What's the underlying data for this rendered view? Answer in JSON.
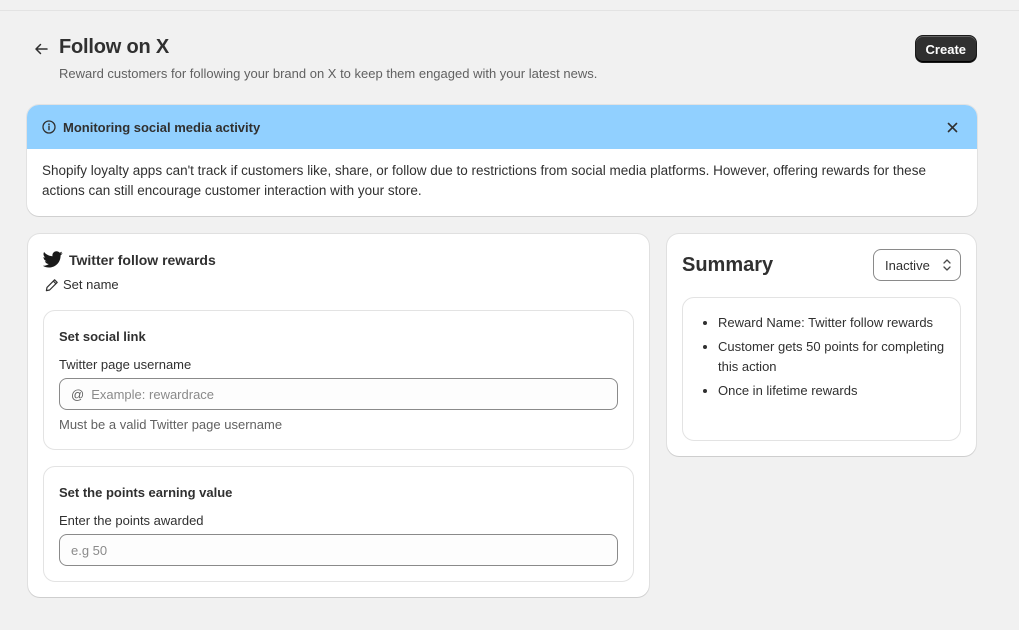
{
  "page": {
    "title": "Follow on X",
    "subtitle": "Reward customers for following your brand on X to keep them engaged with your latest news.",
    "create_label": "Create"
  },
  "banner": {
    "title": "Monitoring social media activity",
    "body": "Shopify loyalty apps can't track if customers like, share, or follow due to restrictions from social media platforms. However, offering rewards for these actions can still encourage customer interaction with your store.",
    "color": "#91d0ff"
  },
  "reward": {
    "title": "Twitter follow rewards",
    "set_name_label": "Set name",
    "social_link": {
      "title": "Set social link",
      "field_label": "Twitter page username",
      "prefix": "@",
      "placeholder": "Example: rewardrace",
      "value": "",
      "help": "Must be a valid Twitter page username"
    },
    "points": {
      "title": "Set the points earning value",
      "field_label": "Enter the points awarded",
      "placeholder": "e.g 50",
      "value": ""
    }
  },
  "summary": {
    "title": "Summary",
    "status": "Inactive",
    "items": [
      "Reward Name: Twitter follow rewards",
      "Customer gets 50 points for completing this action",
      "Once in lifetime rewards"
    ]
  },
  "icons": {
    "back": "arrow-left-icon",
    "info": "info-icon",
    "close": "close-icon",
    "twitter": "twitter-bird-icon",
    "edit": "pencil-icon",
    "status_chevron": "chevron-up-down-icon"
  },
  "colors": {
    "background": "#f1f1f1",
    "primary_button": "#303030",
    "banner": "#91d0ff"
  }
}
